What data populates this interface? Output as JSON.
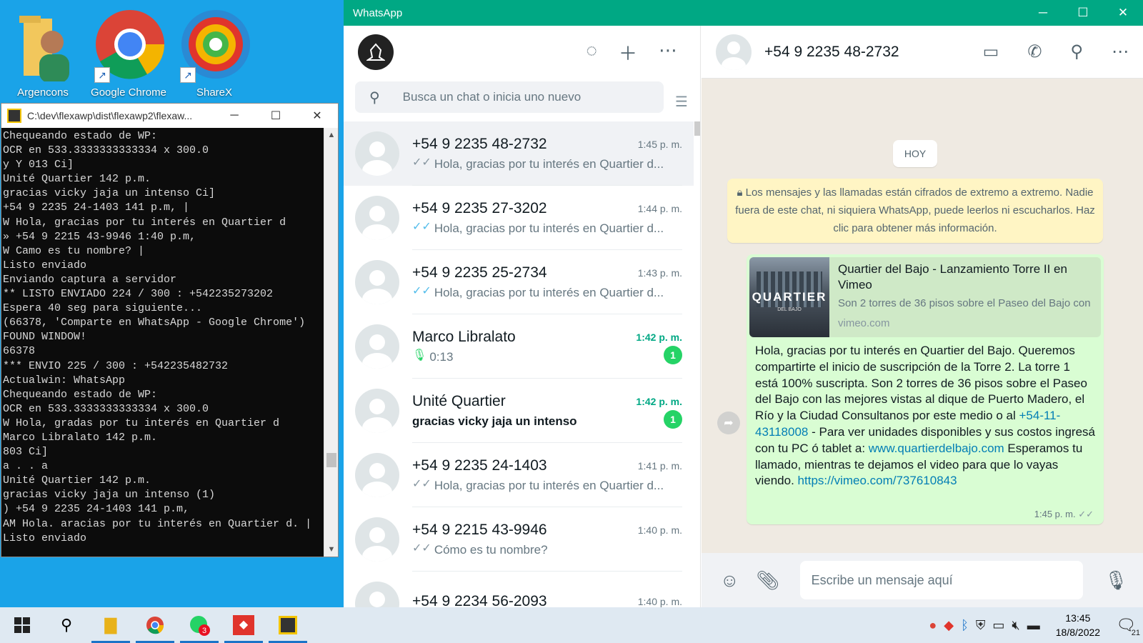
{
  "desktop": {
    "icons": [
      {
        "label": "Argencons"
      },
      {
        "label": "Google Chrome"
      },
      {
        "label": "ShareX"
      }
    ]
  },
  "console": {
    "title": "C:\\dev\\flexawp\\dist\\flexawp2\\flexaw...",
    "lines": [
      "Chequeando estado de WP:",
      "OCR en 533.3333333333334 x 300.0",
      "y Y 013 Ci]",
      "Unité Quartier 142 p.m.",
      "gracias vicky jaja un intenso Ci]",
      "+54 9 2235 24-1403 141 p.m, |",
      "W Hola, gracias por tu interés en Quartier d",
      "» +54 9 2215 43-9946 1:40 p.m,",
      "W Camo es tu nombre? |",
      "Listo enviado",
      "Enviando captura a servidor",
      "** LISTO ENVIADO 224 / 300 : +542235273202",
      "Espera 40 seg para siguiente...",
      "(66378, 'Comparte en WhatsApp - Google Chrome')",
      "FOUND WINDOW!",
      "66378",
      "*** ENVIO 225 / 300 : +542235482732",
      "Actualwin: WhatsApp",
      "Chequeando estado de WP:",
      "OCR en 533.3333333333334 x 300.0",
      "W Hola, gradas por tu interés en Quartier d",
      "Marco Libralato 142 p.m.",
      "803 Ci]",
      "a . . a",
      "Unité Quartier 142 p.m.",
      "gracias vicky jaja un intenso (1)",
      ") +54 9 2235 24-1403 141 p.m,",
      "AM Hola. aracias por tu interés en Quartier d. |",
      "Listo enviado"
    ]
  },
  "whatsapp": {
    "window_title": "WhatsApp",
    "search_placeholder": "Busca un chat o inicia uno nuevo",
    "chats": [
      {
        "name": "+54 9 2235 48-2732",
        "time": "1:45 p. m.",
        "msg": "Hola, gracias por tu interés en Quartier d...",
        "tick": "grey",
        "selected": true
      },
      {
        "name": "+54 9 2235 27-3202",
        "time": "1:44 p. m.",
        "msg": "Hola, gracias por tu interés en Quartier d...",
        "tick": "blue"
      },
      {
        "name": "+54 9 2235 25-2734",
        "time": "1:43 p. m.",
        "msg": "Hola, gracias por tu interés en Quartier d...",
        "tick": "blue"
      },
      {
        "name": "Marco Libralato",
        "time": "1:42 p. m.",
        "msg": "0:13",
        "unread": "1",
        "voice": true
      },
      {
        "name": "Unité Quartier",
        "time": "1:42 p. m.",
        "msg": "gracias vicky jaja un intenso",
        "unread": "1"
      },
      {
        "name": "+54 9 2235 24-1403",
        "time": "1:41 p. m.",
        "msg": "Hola, gracias por tu interés en Quartier d...",
        "tick": "grey"
      },
      {
        "name": "+54 9 2215 43-9946",
        "time": "1:40 p. m.",
        "msg": "Cómo es tu nombre?",
        "tick": "grey"
      },
      {
        "name": "+54 9 2234 56-2093",
        "time": "1:40 p. m.",
        "msg": ""
      }
    ],
    "conversation": {
      "contact": "+54 9 2235 48-2732",
      "day_badge": "HOY",
      "e2e_notice": "Los mensajes y las llamadas están cifrados de extremo a extremo. Nadie fuera de este chat, ni siquiera WhatsApp, puede leerlos ni escucharlos. Haz clic para obtener más información.",
      "preview": {
        "title": "Quartier del Bajo - Lanzamiento Torre II en Vimeo",
        "description": "Son 2 torres de 36 pisos sobre el Paseo del Bajo con",
        "domain": "vimeo.com",
        "thumb_text": "QUARTIER",
        "thumb_sub": "DEL BAJO"
      },
      "message_part1": "Hola, gracias por tu interés en Quartier del Bajo. Queremos compartirte el inicio de suscripción de la Torre 2. La torre 1 está 100% suscripta. Son 2 torres de 36 pisos sobre el Paseo del Bajo con las mejores vistas al dique de Puerto Madero, el Río y la Ciudad Consultanos por este medio o al ",
      "phone_link": "+54-11-43118008",
      "message_part2": " - Para ver unidades disponibles y sus costos ingresá con tu PC ó tablet a: ",
      "site_link": "www.quartierdelbajo.com",
      "message_part3": " Esperamos tu llamado, mientras te dejamos el video para que lo vayas viendo. ",
      "video_link": "https://vimeo.com/737610843",
      "time": "1:45 p. m."
    },
    "composer_placeholder": "Escribe un mensaje aquí"
  },
  "taskbar": {
    "whatsapp_badge": "3",
    "time": "13:45",
    "date": "18/8/2022",
    "notifications": "21"
  }
}
